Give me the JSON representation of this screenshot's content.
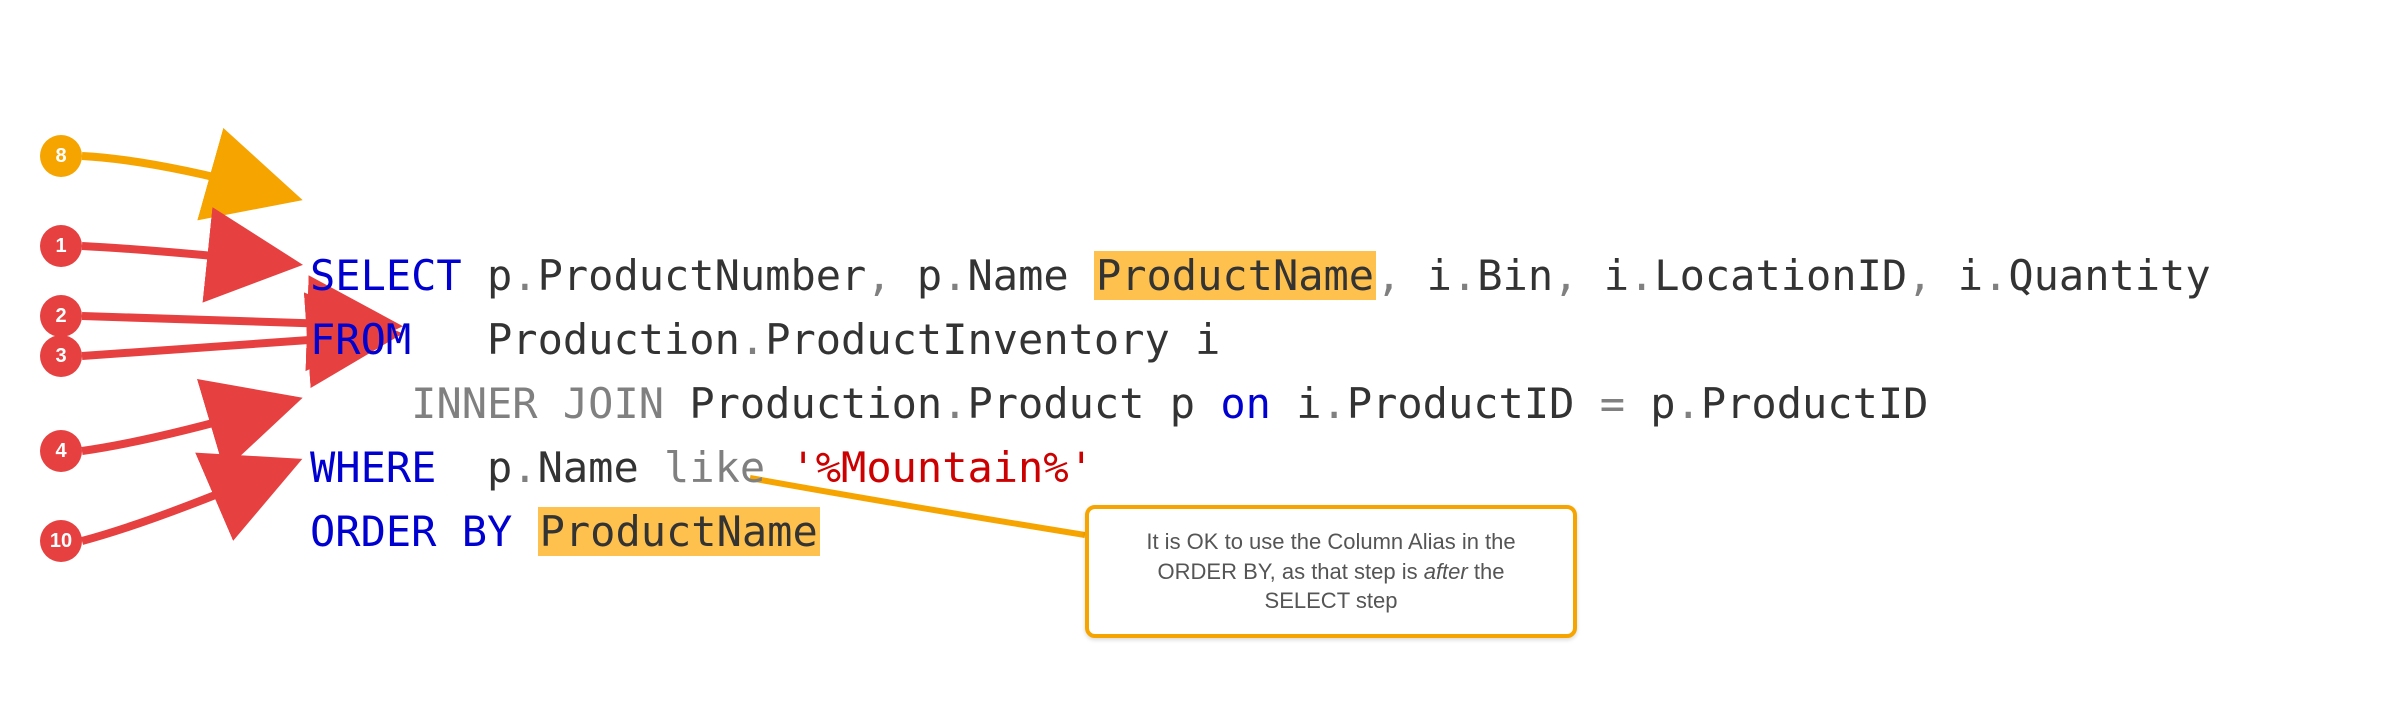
{
  "badges": {
    "b8": "8",
    "b1": "1",
    "b2": "2",
    "b3": "3",
    "b4": "4",
    "b10": "10"
  },
  "code": {
    "line1": {
      "select": "SELECT",
      "p1": " p",
      "dot1": ".",
      "productnumber": "ProductNumber",
      "comma1": ",",
      "p2": " p",
      "dot2": ".",
      "name": "Name ",
      "alias": "ProductName",
      "comma2": ",",
      "i1": " i",
      "dot3": ".",
      "bin": "Bin",
      "comma3": ",",
      "i2": " i",
      "dot4": ".",
      "locationid": "LocationID",
      "comma4": ",",
      "i3": " i",
      "dot5": ".",
      "quantity": "Quantity"
    },
    "line2": {
      "from": "FROM",
      "pad": "   Production",
      "dot": ".",
      "table": "ProductInventory i"
    },
    "line3": {
      "lead": "    ",
      "inner": "INNER",
      "join": " JOIN",
      "prod": " Production",
      "dot1": ".",
      "product": "Product p ",
      "on": "on",
      "i": " i",
      "dot2": ".",
      "pid1": "ProductID ",
      "eq": "=",
      "p": " p",
      "dot3": ".",
      "pid2": "ProductID"
    },
    "line4": {
      "where": "WHERE",
      "p": "  p",
      "dot": ".",
      "name": "Name ",
      "like": "like",
      "sp": " ",
      "literal": "'%Mountain%'"
    },
    "line5": {
      "order": "ORDER",
      "by": " BY",
      "sp": " ",
      "col": "ProductName"
    }
  },
  "callout": {
    "t1": "It is OK to use the Column Alias in the",
    "t2": "ORDER BY, as that step is ",
    "t2i": "after",
    "t2b": " the",
    "t3": "SELECT step"
  }
}
